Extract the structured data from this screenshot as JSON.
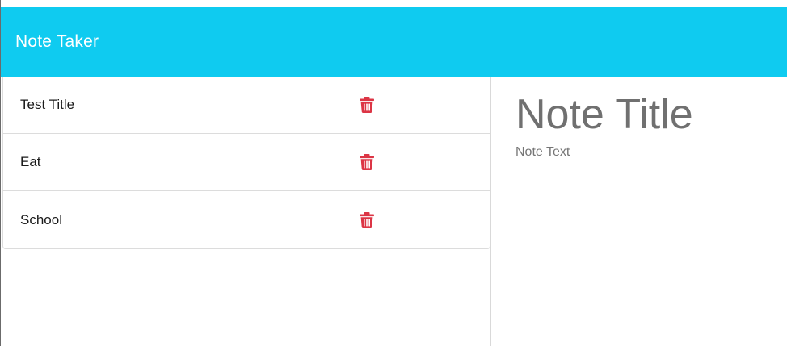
{
  "navbar": {
    "brand": "Note Taker",
    "background": "#0fcbf0"
  },
  "notes": [
    {
      "title": "Test Title",
      "delete_icon": "trash-icon"
    },
    {
      "title": "Eat",
      "delete_icon": "trash-icon"
    },
    {
      "title": "School",
      "delete_icon": "trash-icon"
    }
  ],
  "editor": {
    "title_placeholder": "Note Title",
    "text_placeholder": "Note Text"
  },
  "colors": {
    "delete_icon": "#dc3545"
  }
}
